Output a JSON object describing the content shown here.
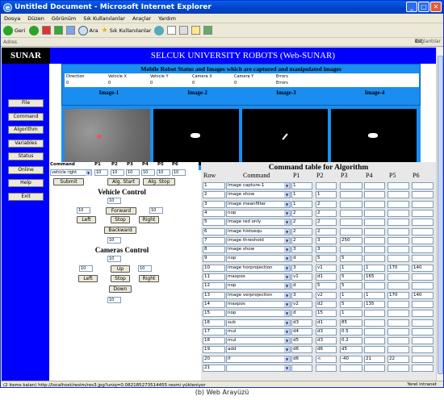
{
  "window": {
    "title": "Untitled Document - Microsoft Internet Explorer"
  },
  "menu": [
    "Dosya",
    "Düzen",
    "Görünüm",
    "Sık Kullanılanlar",
    "Araçlar",
    "Yardım"
  ],
  "toolbar": {
    "back": "Geri",
    "search": "Ara",
    "favorites": "Sık Kullanılanlar"
  },
  "address": {
    "label": "Adres",
    "go": "Git",
    "links": "Bağlantılar"
  },
  "page": {
    "logo": "SUNAR",
    "title": "SELCUK UNIVERSITY ROBOTS (Web-SUNAR)"
  },
  "nav": [
    "File",
    "Command",
    "Algorithm",
    "Variables",
    "Status",
    "Online",
    "Help",
    "Exit"
  ],
  "status_block": {
    "title": "Mobile Robot Status and Images which are captured and manipulated images",
    "headers": [
      "Direction",
      "Vehicle X",
      "Vehicle Y",
      "Camera X",
      "Camera Y",
      "Errors"
    ],
    "values": [
      "0",
      "0",
      "0",
      "0",
      "0",
      "Errors"
    ]
  },
  "images": [
    "Image-1",
    "Image-2",
    "Image-3",
    "Image-4"
  ],
  "command": {
    "label": "Command",
    "params": [
      "P1",
      "P2",
      "P3",
      "P4",
      "P5",
      "P6"
    ],
    "selected": "vehicle right",
    "values": [
      "10",
      "10",
      "10",
      "10",
      "10",
      "10"
    ],
    "submit": "Submit",
    "alg_start": "Alg. Start",
    "alg_stop": "Alg. Stop"
  },
  "vehicle_control": {
    "title": "Vehicle Control",
    "top": "10",
    "left_val": "10",
    "right_val": "10",
    "bottom": "10",
    "forward": "Forward",
    "left": "Left",
    "stop": "Stop",
    "right": "Right",
    "backward": "Backward"
  },
  "camera_control": {
    "title": "Cameras Control",
    "top": "10",
    "left_val": "10",
    "right_val": "10",
    "bottom": "10",
    "up": "Up",
    "left": "Left",
    "stop": "Stop",
    "right": "Right",
    "down": "Down"
  },
  "algorithm": {
    "title": "Command table for Algorithm",
    "headers": [
      "Row",
      "Command",
      "P1",
      "P2",
      "P3",
      "P4",
      "P5",
      "P6"
    ],
    "rows": [
      [
        "1",
        "image capture-1",
        "1",
        "",
        "",
        "",
        "",
        ""
      ],
      [
        "2",
        "image show",
        "1",
        "1",
        "",
        "",
        "",
        ""
      ],
      [
        "3",
        "image meanfilter",
        "1",
        "2",
        "",
        "",
        "",
        ""
      ],
      [
        "4",
        "nop",
        "2",
        "2",
        "",
        "",
        "",
        ""
      ],
      [
        "5",
        "image red only",
        "2",
        "2",
        "",
        "",
        "",
        ""
      ],
      [
        "6",
        "image histoequ",
        "2",
        "2",
        "",
        "",
        "",
        ""
      ],
      [
        "7",
        "image threshold",
        "2",
        "3",
        "250",
        "",
        "",
        ""
      ],
      [
        "8",
        "image show",
        "3",
        "3",
        "",
        "",
        "",
        ""
      ],
      [
        "9",
        "nop",
        "d",
        "5",
        "5",
        "",
        "",
        ""
      ],
      [
        "10",
        "image horprojection",
        "3",
        "v1",
        "1",
        "1",
        "170",
        "140"
      ],
      [
        "11",
        "maxpos",
        "v1",
        "d1",
        "5",
        "165",
        "",
        ""
      ],
      [
        "12",
        "nop",
        "d",
        "5",
        "5",
        "",
        "",
        ""
      ],
      [
        "13",
        "image verprojection",
        "3",
        "v2",
        "1",
        "1",
        "170",
        "140"
      ],
      [
        "14",
        "maxpos",
        "v2",
        "d2",
        "5",
        "135",
        "",
        ""
      ],
      [
        "15",
        "nop",
        "d",
        "15",
        "1",
        "",
        "",
        ""
      ],
      [
        "16",
        "sub",
        "d3",
        "d1",
        "85",
        "",
        "",
        ""
      ],
      [
        "17",
        "mul",
        "d4",
        "d3",
        "0.5",
        "",
        "",
        ""
      ],
      [
        "18",
        "mul",
        "d5",
        "d3",
        "0.2",
        "",
        "",
        ""
      ],
      [
        "19",
        "add",
        "d6",
        "d6",
        "d5",
        "",
        "",
        ""
      ],
      [
        "20",
        "if",
        "d6",
        "<",
        "-40",
        "21",
        "22",
        ""
      ],
      [
        "21",
        "",
        "",
        "",
        "",
        "",
        "",
        ""
      ]
    ]
  },
  "statusbar": {
    "text": "(2 items kalan) http://localhost/resim/res3.jpg?uniq=0.082185273514455 resmi yükleniyor",
    "zone": "Yerel intranet"
  },
  "caption": "(b) Web Arayüzü"
}
